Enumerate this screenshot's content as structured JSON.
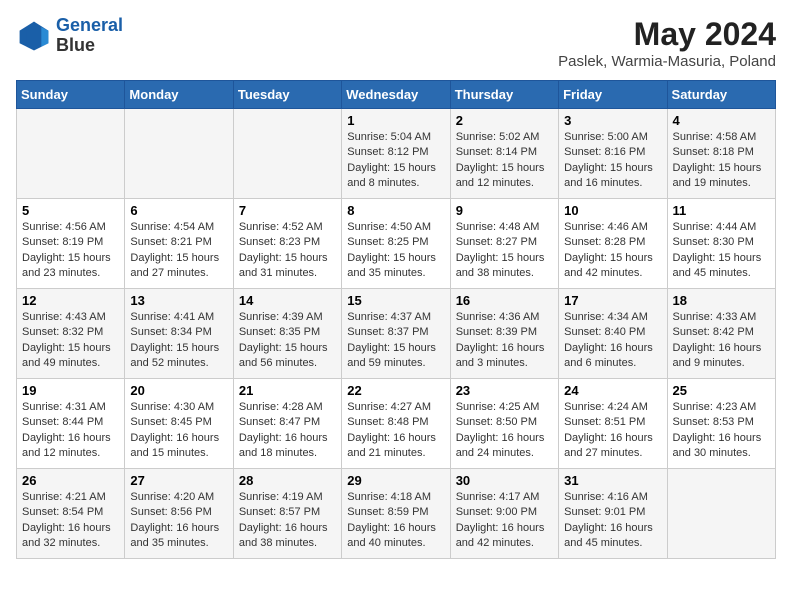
{
  "header": {
    "logo_line1": "General",
    "logo_line2": "Blue",
    "title": "May 2024",
    "subtitle": "Paslek, Warmia-Masuria, Poland"
  },
  "days_of_week": [
    "Sunday",
    "Monday",
    "Tuesday",
    "Wednesday",
    "Thursday",
    "Friday",
    "Saturday"
  ],
  "weeks": [
    [
      {
        "day": "",
        "info": ""
      },
      {
        "day": "",
        "info": ""
      },
      {
        "day": "",
        "info": ""
      },
      {
        "day": "1",
        "info": "Sunrise: 5:04 AM\nSunset: 8:12 PM\nDaylight: 15 hours\nand 8 minutes."
      },
      {
        "day": "2",
        "info": "Sunrise: 5:02 AM\nSunset: 8:14 PM\nDaylight: 15 hours\nand 12 minutes."
      },
      {
        "day": "3",
        "info": "Sunrise: 5:00 AM\nSunset: 8:16 PM\nDaylight: 15 hours\nand 16 minutes."
      },
      {
        "day": "4",
        "info": "Sunrise: 4:58 AM\nSunset: 8:18 PM\nDaylight: 15 hours\nand 19 minutes."
      }
    ],
    [
      {
        "day": "5",
        "info": "Sunrise: 4:56 AM\nSunset: 8:19 PM\nDaylight: 15 hours\nand 23 minutes."
      },
      {
        "day": "6",
        "info": "Sunrise: 4:54 AM\nSunset: 8:21 PM\nDaylight: 15 hours\nand 27 minutes."
      },
      {
        "day": "7",
        "info": "Sunrise: 4:52 AM\nSunset: 8:23 PM\nDaylight: 15 hours\nand 31 minutes."
      },
      {
        "day": "8",
        "info": "Sunrise: 4:50 AM\nSunset: 8:25 PM\nDaylight: 15 hours\nand 35 minutes."
      },
      {
        "day": "9",
        "info": "Sunrise: 4:48 AM\nSunset: 8:27 PM\nDaylight: 15 hours\nand 38 minutes."
      },
      {
        "day": "10",
        "info": "Sunrise: 4:46 AM\nSunset: 8:28 PM\nDaylight: 15 hours\nand 42 minutes."
      },
      {
        "day": "11",
        "info": "Sunrise: 4:44 AM\nSunset: 8:30 PM\nDaylight: 15 hours\nand 45 minutes."
      }
    ],
    [
      {
        "day": "12",
        "info": "Sunrise: 4:43 AM\nSunset: 8:32 PM\nDaylight: 15 hours\nand 49 minutes."
      },
      {
        "day": "13",
        "info": "Sunrise: 4:41 AM\nSunset: 8:34 PM\nDaylight: 15 hours\nand 52 minutes."
      },
      {
        "day": "14",
        "info": "Sunrise: 4:39 AM\nSunset: 8:35 PM\nDaylight: 15 hours\nand 56 minutes."
      },
      {
        "day": "15",
        "info": "Sunrise: 4:37 AM\nSunset: 8:37 PM\nDaylight: 15 hours\nand 59 minutes."
      },
      {
        "day": "16",
        "info": "Sunrise: 4:36 AM\nSunset: 8:39 PM\nDaylight: 16 hours\nand 3 minutes."
      },
      {
        "day": "17",
        "info": "Sunrise: 4:34 AM\nSunset: 8:40 PM\nDaylight: 16 hours\nand 6 minutes."
      },
      {
        "day": "18",
        "info": "Sunrise: 4:33 AM\nSunset: 8:42 PM\nDaylight: 16 hours\nand 9 minutes."
      }
    ],
    [
      {
        "day": "19",
        "info": "Sunrise: 4:31 AM\nSunset: 8:44 PM\nDaylight: 16 hours\nand 12 minutes."
      },
      {
        "day": "20",
        "info": "Sunrise: 4:30 AM\nSunset: 8:45 PM\nDaylight: 16 hours\nand 15 minutes."
      },
      {
        "day": "21",
        "info": "Sunrise: 4:28 AM\nSunset: 8:47 PM\nDaylight: 16 hours\nand 18 minutes."
      },
      {
        "day": "22",
        "info": "Sunrise: 4:27 AM\nSunset: 8:48 PM\nDaylight: 16 hours\nand 21 minutes."
      },
      {
        "day": "23",
        "info": "Sunrise: 4:25 AM\nSunset: 8:50 PM\nDaylight: 16 hours\nand 24 minutes."
      },
      {
        "day": "24",
        "info": "Sunrise: 4:24 AM\nSunset: 8:51 PM\nDaylight: 16 hours\nand 27 minutes."
      },
      {
        "day": "25",
        "info": "Sunrise: 4:23 AM\nSunset: 8:53 PM\nDaylight: 16 hours\nand 30 minutes."
      }
    ],
    [
      {
        "day": "26",
        "info": "Sunrise: 4:21 AM\nSunset: 8:54 PM\nDaylight: 16 hours\nand 32 minutes."
      },
      {
        "day": "27",
        "info": "Sunrise: 4:20 AM\nSunset: 8:56 PM\nDaylight: 16 hours\nand 35 minutes."
      },
      {
        "day": "28",
        "info": "Sunrise: 4:19 AM\nSunset: 8:57 PM\nDaylight: 16 hours\nand 38 minutes."
      },
      {
        "day": "29",
        "info": "Sunrise: 4:18 AM\nSunset: 8:59 PM\nDaylight: 16 hours\nand 40 minutes."
      },
      {
        "day": "30",
        "info": "Sunrise: 4:17 AM\nSunset: 9:00 PM\nDaylight: 16 hours\nand 42 minutes."
      },
      {
        "day": "31",
        "info": "Sunrise: 4:16 AM\nSunset: 9:01 PM\nDaylight: 16 hours\nand 45 minutes."
      },
      {
        "day": "",
        "info": ""
      }
    ]
  ]
}
